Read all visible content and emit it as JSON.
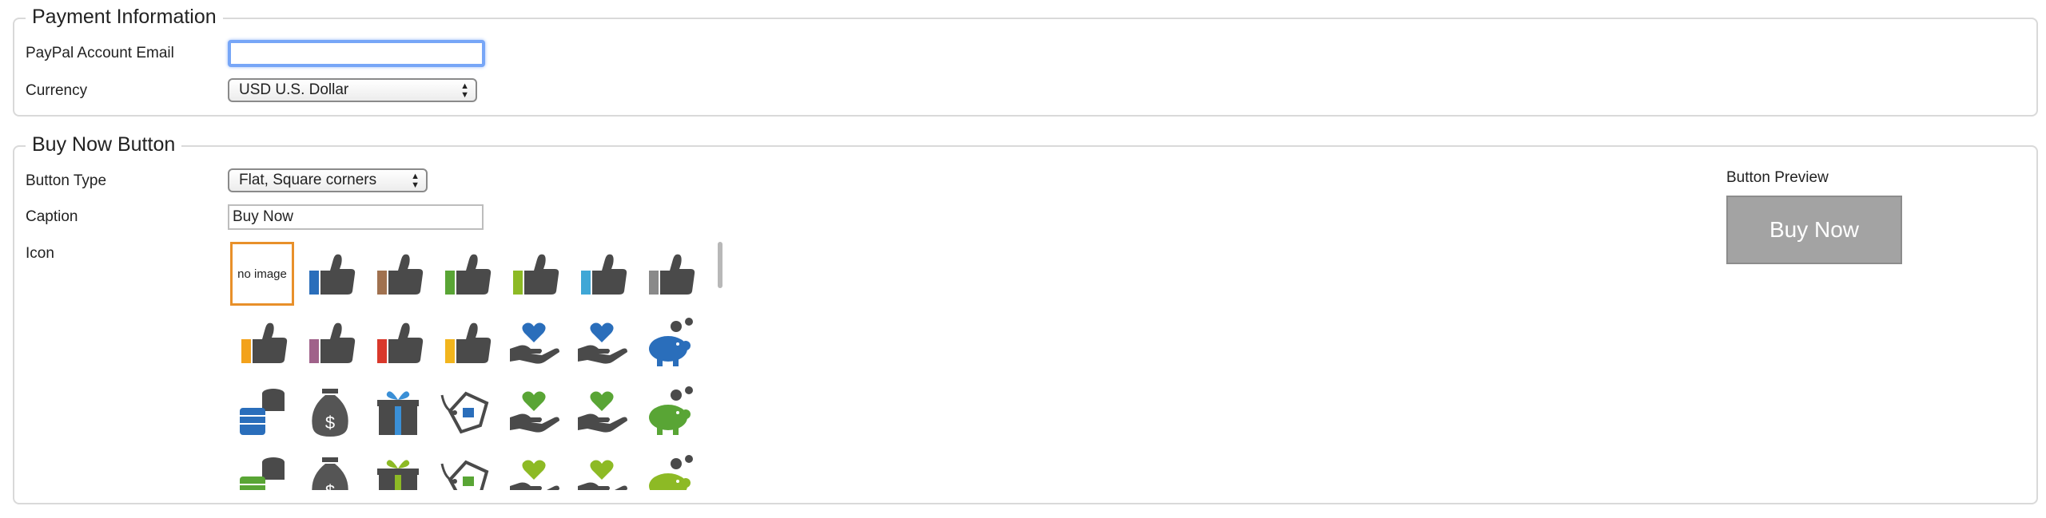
{
  "payment": {
    "legend": "Payment Information",
    "email_label": "PayPal Account Email",
    "email_value": "",
    "currency_label": "Currency",
    "currency_value": "USD U.S. Dollar"
  },
  "buynow": {
    "legend": "Buy Now Button",
    "type_label": "Button Type",
    "type_value": "Flat, Square corners",
    "caption_label": "Caption",
    "caption_value": "Buy Now",
    "icon_label": "Icon",
    "no_image_text": "no image",
    "preview_label": "Button Preview",
    "preview_caption": "Buy Now"
  },
  "icons": [
    [
      "no-image",
      "thumb",
      "thumb",
      "thumb",
      "thumb",
      "thumb",
      "thumb"
    ],
    [
      "thumb",
      "thumb",
      "thumb",
      "thumb",
      "hand-heart",
      "hand-heart",
      "piggy-bank"
    ],
    [
      "coins",
      "money-bag",
      "gift",
      "price-tag",
      "hand-heart",
      "hand-heart",
      "piggy-bank"
    ],
    [
      "coins",
      "money-bag",
      "gift",
      "price-tag",
      "hand-heart",
      "hand-heart",
      "piggy-bank"
    ]
  ],
  "icon_colors": [
    [
      null,
      "#2a6ebb",
      "#a0714f",
      "#59a535",
      "#8dba25",
      "#3fa7d6",
      "#8a8a8a"
    ],
    [
      "#f3a21b",
      "#a0628a",
      "#d9382b",
      "#f2b51d",
      "#2a6ebb",
      "#2a6ebb",
      "#2a6ebb"
    ],
    [
      "#2a6ebb",
      "#555555",
      "#3a8fd6",
      "#2a6ebb",
      "#59a535",
      "#59a535",
      "#59a535"
    ],
    [
      "#59a535",
      "#555555",
      "#8dba25",
      "#59a535",
      "#8dba25",
      "#8dba25",
      "#8dba25"
    ]
  ]
}
